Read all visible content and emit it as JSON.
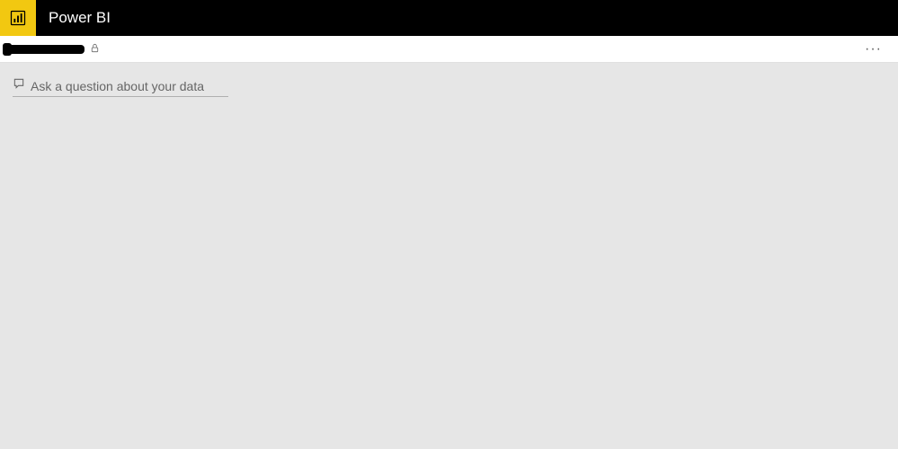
{
  "header": {
    "app_title": "Power BI"
  },
  "subheader": {
    "more_label": "···"
  },
  "qna": {
    "placeholder": "Ask a question about your data"
  }
}
